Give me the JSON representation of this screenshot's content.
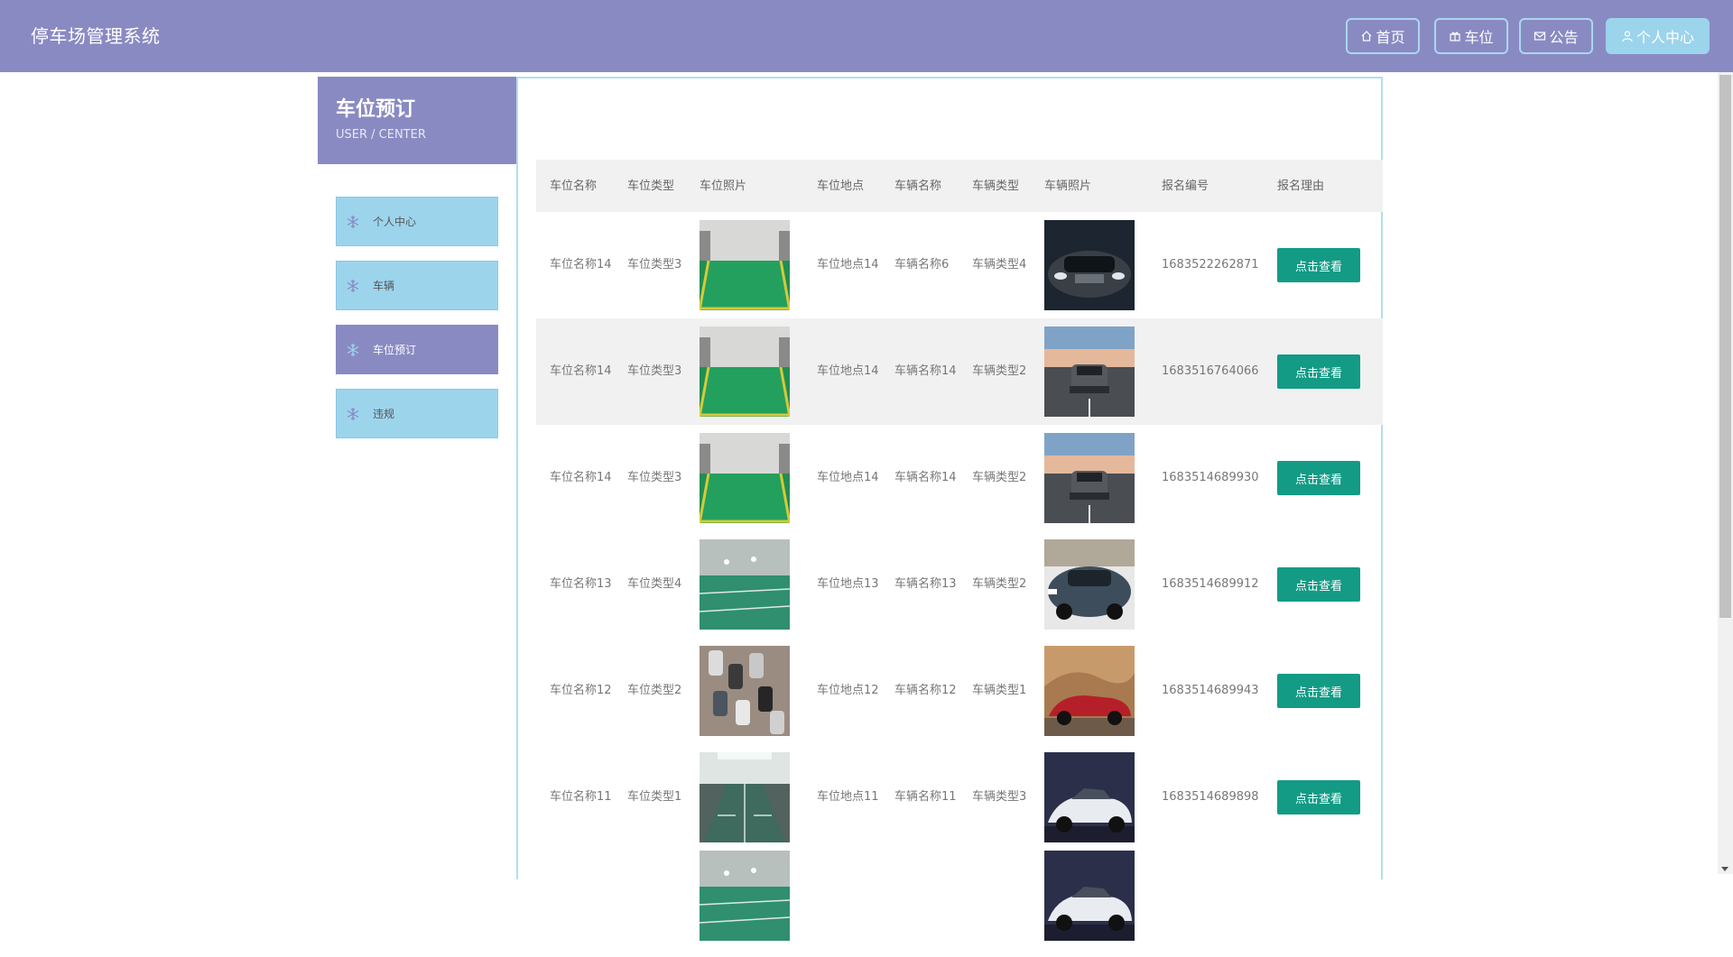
{
  "header": {
    "brand": "停车场管理系统",
    "nav": [
      {
        "label": "首页",
        "icon": "home-icon"
      },
      {
        "label": "车位",
        "icon": "gift-icon"
      },
      {
        "label": "公告",
        "icon": "mail-icon"
      },
      {
        "label": "个人中心",
        "icon": "user-icon"
      }
    ]
  },
  "sidebar": {
    "title": "车位预订",
    "subtitle": "USER / CENTER",
    "items": [
      {
        "label": "个人中心"
      },
      {
        "label": "车辆"
      },
      {
        "label": "车位预订"
      },
      {
        "label": "违规"
      }
    ]
  },
  "table": {
    "columns": [
      "车位名称",
      "车位类型",
      "车位照片",
      "车位地点",
      "车辆名称",
      "车辆类型",
      "车辆照片",
      "报名编号",
      "报名理由"
    ],
    "button_label": "点击查看",
    "rows": [
      {
        "spot_name": "车位名称14",
        "spot_type": "车位类型3",
        "spot_location": "车位地点14",
        "car_name": "车辆名称6",
        "car_type": "车辆类型4",
        "reg_no": "1683522262871"
      },
      {
        "spot_name": "车位名称14",
        "spot_type": "车位类型3",
        "spot_location": "车位地点14",
        "car_name": "车辆名称14",
        "car_type": "车辆类型2",
        "reg_no": "1683516764066"
      },
      {
        "spot_name": "车位名称14",
        "spot_type": "车位类型3",
        "spot_location": "车位地点14",
        "car_name": "车辆名称14",
        "car_type": "车辆类型2",
        "reg_no": "1683514689930"
      },
      {
        "spot_name": "车位名称13",
        "spot_type": "车位类型4",
        "spot_location": "车位地点13",
        "car_name": "车辆名称13",
        "car_type": "车辆类型2",
        "reg_no": "1683514689912"
      },
      {
        "spot_name": "车位名称12",
        "spot_type": "车位类型2",
        "spot_location": "车位地点12",
        "car_name": "车辆名称12",
        "car_type": "车辆类型1",
        "reg_no": "1683514689943"
      },
      {
        "spot_name": "车位名称11",
        "spot_type": "车位类型1",
        "spot_location": "车位地点11",
        "car_name": "车辆名称11",
        "car_type": "车辆类型3",
        "reg_no": "1683514689898"
      }
    ]
  }
}
